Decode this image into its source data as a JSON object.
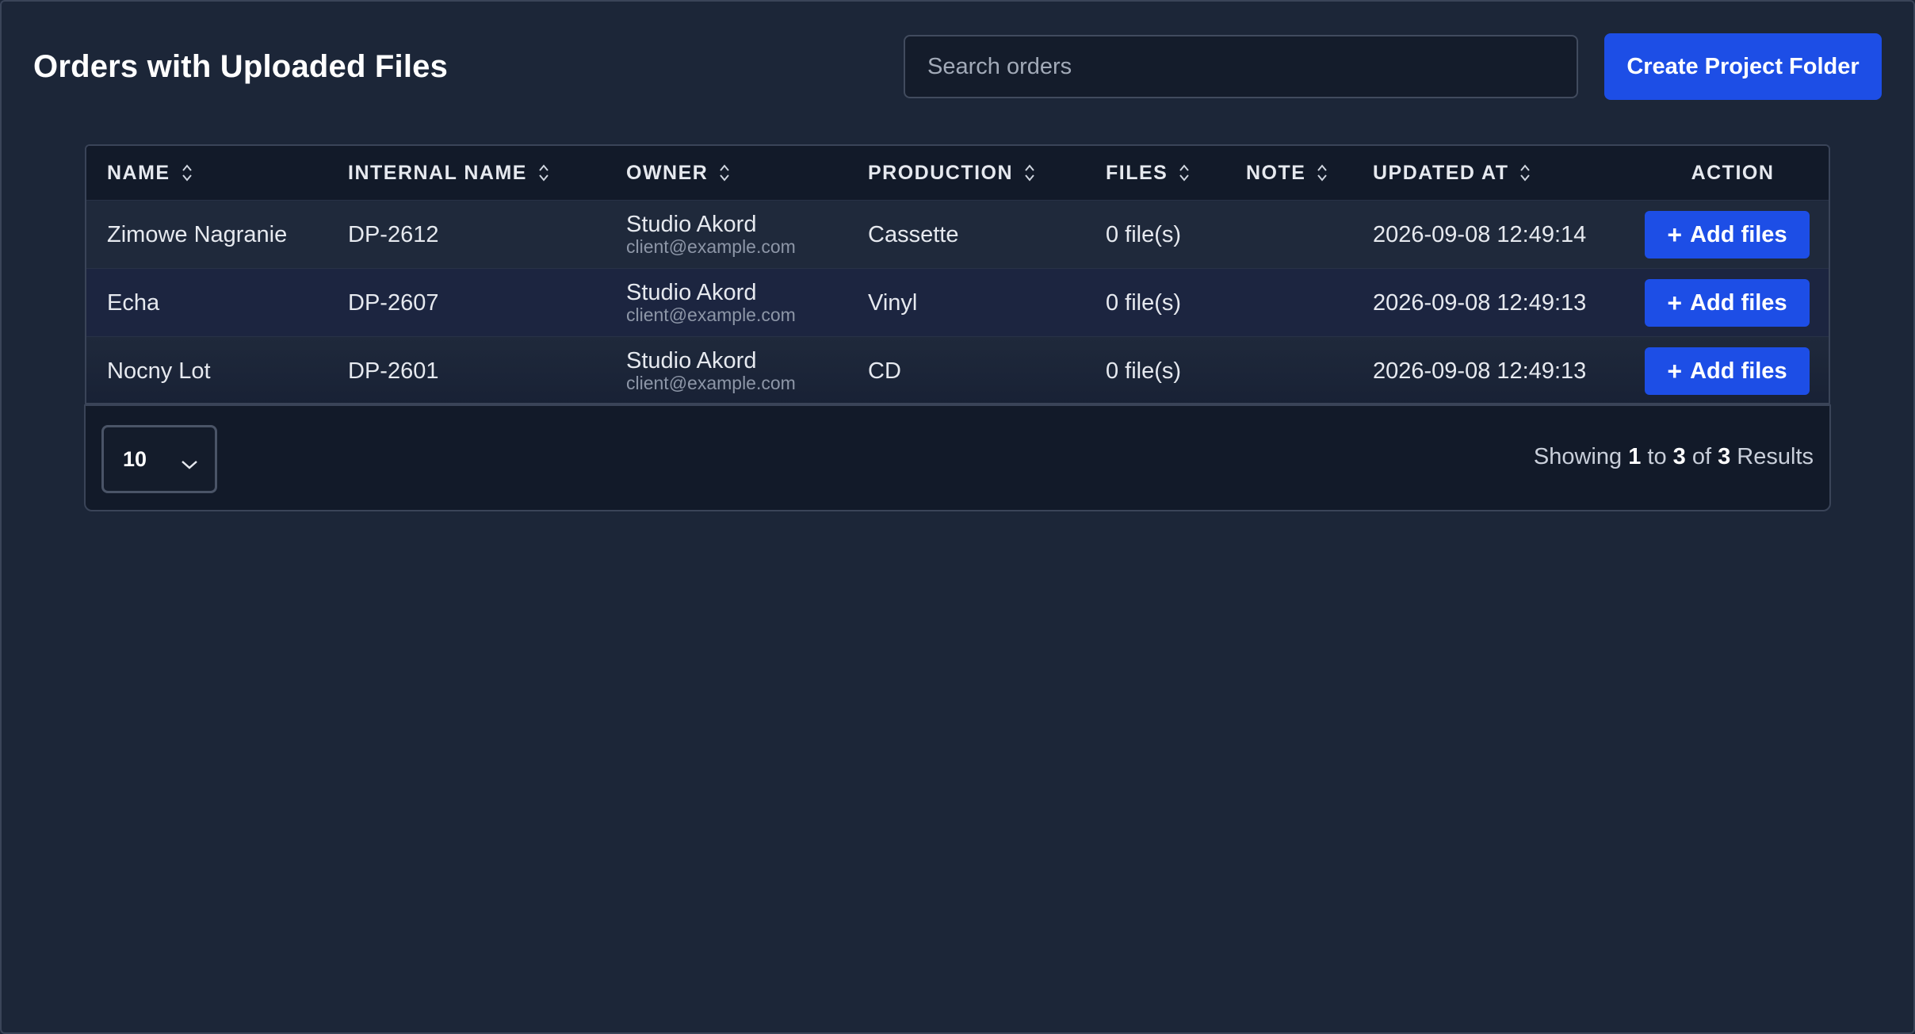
{
  "header": {
    "title": "Orders with Uploaded Files",
    "search_placeholder": "Search orders",
    "create_label": "Create Project Folder"
  },
  "table": {
    "columns": [
      "NAME",
      "INTERNAL NAME",
      "OWNER",
      "PRODUCTION",
      "FILES",
      "NOTE",
      "UPDATED AT",
      "ACTION"
    ],
    "rows": [
      {
        "name": "Zimowe Nagranie",
        "internal": "DP-2612",
        "owner_name": "Studio Akord",
        "owner_email": "client@example.com",
        "production": "Cassette",
        "files": "0 file(s)",
        "note": "",
        "updated": "2026-09-08 12:49:14",
        "action": "Add files"
      },
      {
        "name": "Echa",
        "internal": "DP-2607",
        "owner_name": "Studio Akord",
        "owner_email": "client@example.com",
        "production": "Vinyl",
        "files": "0 file(s)",
        "note": "",
        "updated": "2026-09-08 12:49:13",
        "action": "Add files"
      },
      {
        "name": "Nocny Lot",
        "internal": "DP-2601",
        "owner_name": "Studio Akord",
        "owner_email": "client@example.com",
        "production": "CD",
        "files": "0 file(s)",
        "note": "",
        "updated": "2026-09-08 12:49:13",
        "action": "Add files"
      }
    ]
  },
  "pagination": {
    "page_size": "10",
    "showing_label": "Showing",
    "from": "1",
    "to_label": "to",
    "to": "3",
    "of_label": "of",
    "total": "3",
    "results_label": "Results"
  },
  "icons": {
    "sort": "sort-icon",
    "plus": "plus-icon",
    "chevron": "chevron-down-icon"
  },
  "colors": {
    "accent": "#1d4ee6",
    "background": "#1c2638",
    "header_bg": "#121a29"
  }
}
